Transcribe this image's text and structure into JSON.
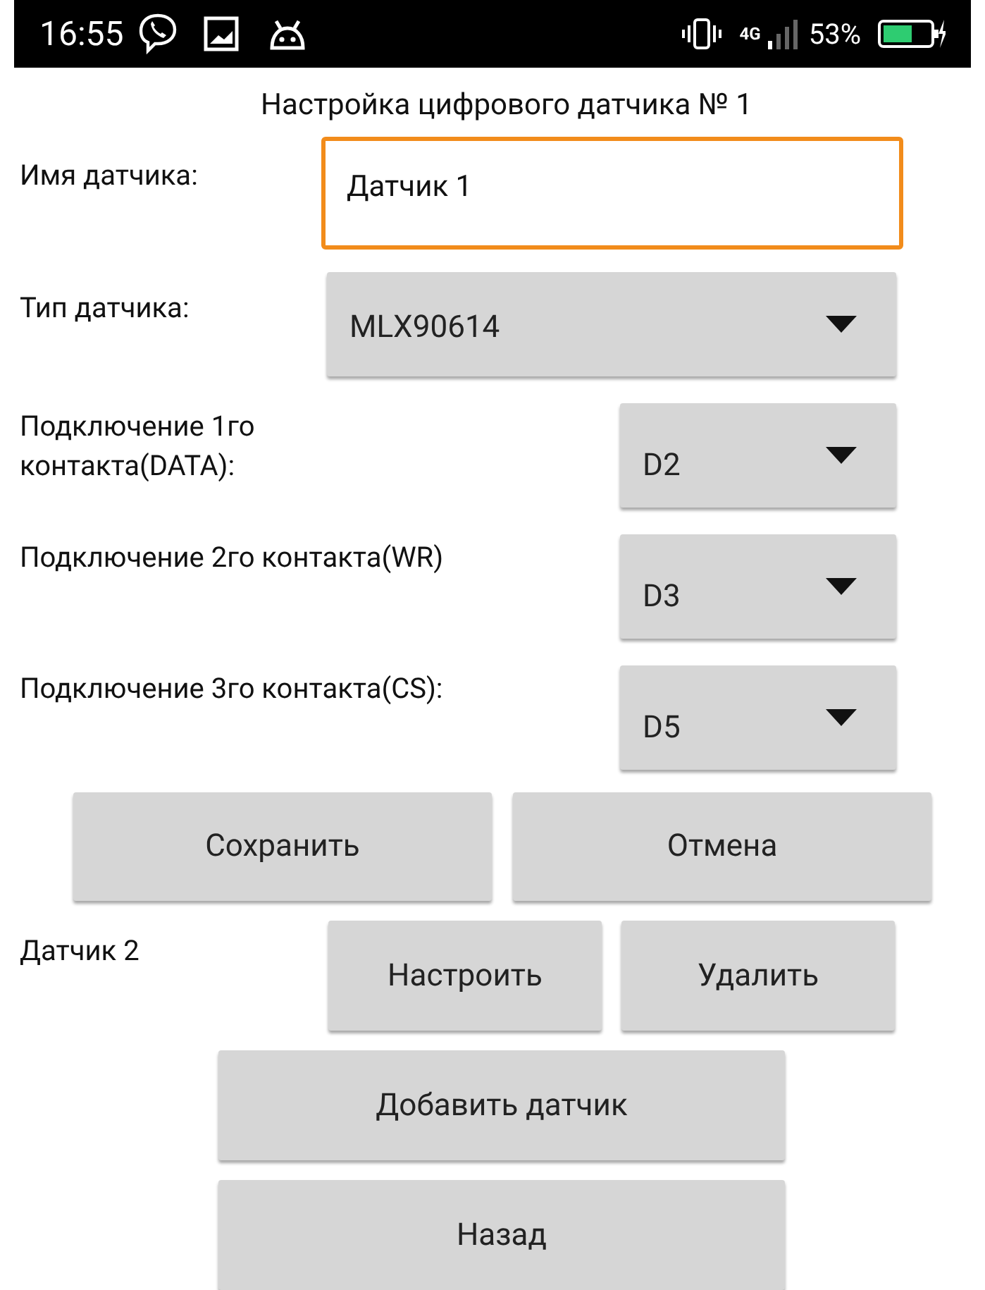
{
  "status_bar": {
    "time": "16:55",
    "network": "4G",
    "battery": "53%"
  },
  "title": "Настройка цифрового датчика № 1",
  "name_field": {
    "label": "Имя датчика:",
    "value": "Датчик 1",
    "focused": true
  },
  "type_select": {
    "label": "Тип датчика:",
    "value": "MLX90614"
  },
  "pins": [
    {
      "label": "Подключение 1го контакта(DATA):",
      "value": "D2"
    },
    {
      "label": "Подключение 2го контакта(WR)",
      "value": "D3"
    },
    {
      "label": "Подключение 3го контакта(CS):",
      "value": "D5"
    }
  ],
  "actions": [
    "Сохранить",
    "Отмена"
  ],
  "sensors": [
    {
      "name": "Датчик 2",
      "buttons": [
        "Настроить",
        "Удалить"
      ]
    }
  ],
  "bottom_buttons": [
    "Добавить датчик",
    "Назад"
  ]
}
